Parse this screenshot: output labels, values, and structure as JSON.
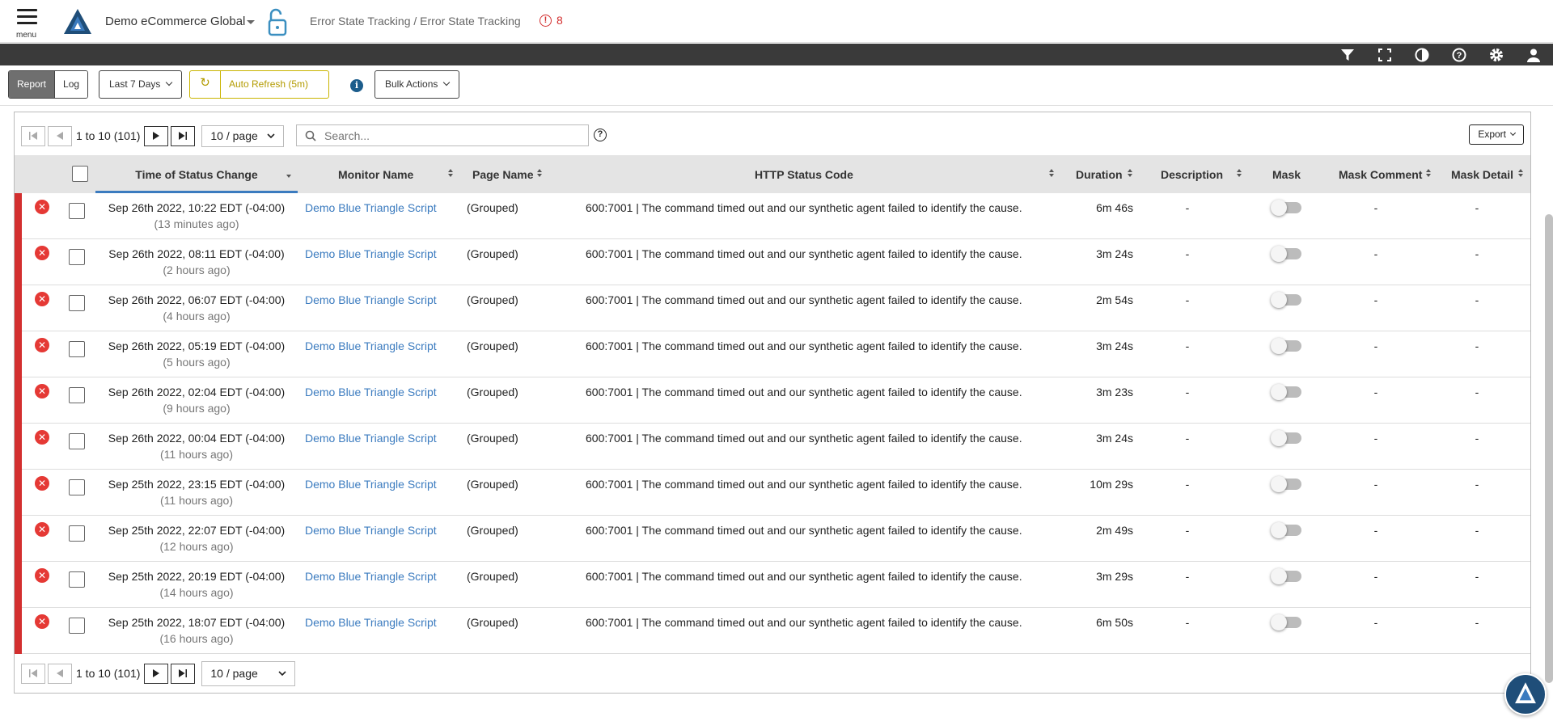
{
  "header": {
    "menu_label": "menu",
    "org_name": "Demo eCommerce Global",
    "breadcrumb": "Error State Tracking / Error State Tracking",
    "alert_count": "8",
    "alert_glyph": "!"
  },
  "colors": {
    "accent_blue": "#3b7bbf",
    "error_red": "#d32f2f",
    "refresh_gold": "#b39b00",
    "dark_toolbar": "#3a3a3a"
  },
  "toolbar_icons": [
    "filter-icon",
    "fullscreen-icon",
    "contrast-icon",
    "help-icon",
    "settings-icon",
    "user-icon"
  ],
  "controls": {
    "view_tabs": [
      "Report",
      "Log"
    ],
    "active_view": "Report",
    "date_range": "Last 7 Days",
    "auto_refresh": "Auto Refresh (5m)",
    "info_glyph": "i",
    "bulk_actions": "Bulk Actions"
  },
  "pager": {
    "range_text": "1 to 10 (101)",
    "page_size": "10 / page"
  },
  "search": {
    "placeholder": "Search...",
    "help_glyph": "?"
  },
  "export_label": "Export",
  "table": {
    "columns": {
      "time": "Time of Status Change",
      "monitor": "Monitor Name",
      "page": "Page Name",
      "code": "HTTP Status Code",
      "duration": "Duration",
      "description": "Description",
      "mask": "Mask",
      "mask_comment": "Mask Comment",
      "mask_detail": "Mask Detail"
    },
    "rows": [
      {
        "time": "Sep 26th 2022, 10:22 EDT (-04:00)",
        "ago": "(13 minutes ago)",
        "monitor": "Demo Blue Triangle Script",
        "page": "(Grouped)",
        "code": "600:7001 | The command timed out and our synthetic agent failed to identify the cause.",
        "duration": "6m 46s",
        "description": "-",
        "mask_comment": "-",
        "mask_detail": "-"
      },
      {
        "time": "Sep 26th 2022, 08:11 EDT (-04:00)",
        "ago": "(2 hours ago)",
        "monitor": "Demo Blue Triangle Script",
        "page": "(Grouped)",
        "code": "600:7001 | The command timed out and our synthetic agent failed to identify the cause.",
        "duration": "3m 24s",
        "description": "-",
        "mask_comment": "-",
        "mask_detail": "-"
      },
      {
        "time": "Sep 26th 2022, 06:07 EDT (-04:00)",
        "ago": "(4 hours ago)",
        "monitor": "Demo Blue Triangle Script",
        "page": "(Grouped)",
        "code": "600:7001 | The command timed out and our synthetic agent failed to identify the cause.",
        "duration": "2m 54s",
        "description": "-",
        "mask_comment": "-",
        "mask_detail": "-"
      },
      {
        "time": "Sep 26th 2022, 05:19 EDT (-04:00)",
        "ago": "(5 hours ago)",
        "monitor": "Demo Blue Triangle Script",
        "page": "(Grouped)",
        "code": "600:7001 | The command timed out and our synthetic agent failed to identify the cause.",
        "duration": "3m 24s",
        "description": "-",
        "mask_comment": "-",
        "mask_detail": "-"
      },
      {
        "time": "Sep 26th 2022, 02:04 EDT (-04:00)",
        "ago": "(9 hours ago)",
        "monitor": "Demo Blue Triangle Script",
        "page": "(Grouped)",
        "code": "600:7001 | The command timed out and our synthetic agent failed to identify the cause.",
        "duration": "3m 23s",
        "description": "-",
        "mask_comment": "-",
        "mask_detail": "-"
      },
      {
        "time": "Sep 26th 2022, 00:04 EDT (-04:00)",
        "ago": "(11 hours ago)",
        "monitor": "Demo Blue Triangle Script",
        "page": "(Grouped)",
        "code": "600:7001 | The command timed out and our synthetic agent failed to identify the cause.",
        "duration": "3m 24s",
        "description": "-",
        "mask_comment": "-",
        "mask_detail": "-"
      },
      {
        "time": "Sep 25th 2022, 23:15 EDT (-04:00)",
        "ago": "(11 hours ago)",
        "monitor": "Demo Blue Triangle Script",
        "page": "(Grouped)",
        "code": "600:7001 | The command timed out and our synthetic agent failed to identify the cause.",
        "duration": "10m 29s",
        "description": "-",
        "mask_comment": "-",
        "mask_detail": "-"
      },
      {
        "time": "Sep 25th 2022, 22:07 EDT (-04:00)",
        "ago": "(12 hours ago)",
        "monitor": "Demo Blue Triangle Script",
        "page": "(Grouped)",
        "code": "600:7001 | The command timed out and our synthetic agent failed to identify the cause.",
        "duration": "2m 49s",
        "description": "-",
        "mask_comment": "-",
        "mask_detail": "-"
      },
      {
        "time": "Sep 25th 2022, 20:19 EDT (-04:00)",
        "ago": "(14 hours ago)",
        "monitor": "Demo Blue Triangle Script",
        "page": "(Grouped)",
        "code": "600:7001 | The command timed out and our synthetic agent failed to identify the cause.",
        "duration": "3m 29s",
        "description": "-",
        "mask_comment": "-",
        "mask_detail": "-"
      },
      {
        "time": "Sep 25th 2022, 18:07 EDT (-04:00)",
        "ago": "(16 hours ago)",
        "monitor": "Demo Blue Triangle Script",
        "page": "(Grouped)",
        "code": "600:7001 | The command timed out and our synthetic agent failed to identify the cause.",
        "duration": "6m 50s",
        "description": "-",
        "mask_comment": "-",
        "mask_detail": "-"
      }
    ]
  }
}
